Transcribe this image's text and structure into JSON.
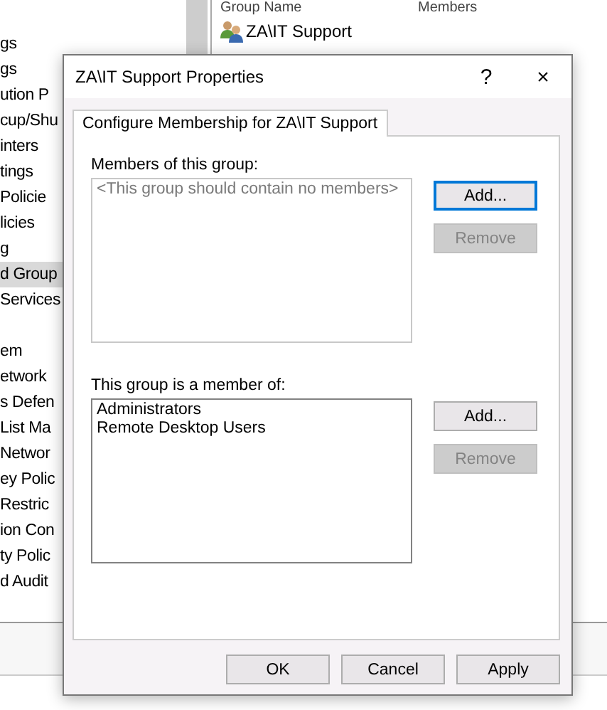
{
  "tree": {
    "items": [
      {
        "label": "gs",
        "selected": false
      },
      {
        "label": "gs",
        "selected": false
      },
      {
        "label": "ution P",
        "selected": false
      },
      {
        "label": "cup/Shu",
        "selected": false
      },
      {
        "label": "inters",
        "selected": false
      },
      {
        "label": "tings",
        "selected": false
      },
      {
        "label": "Policie",
        "selected": false
      },
      {
        "label": "licies",
        "selected": false
      },
      {
        "label": "g",
        "selected": false
      },
      {
        "label": "d Group",
        "selected": true
      },
      {
        "label": "Services",
        "selected": false
      },
      {
        "selected": false
      },
      {
        "label": "em",
        "selected": false
      },
      {
        "label": "etwork",
        "selected": false
      },
      {
        "label": "s Defen",
        "selected": false
      },
      {
        "label": "List Ma",
        "selected": false
      },
      {
        "label": "Networ",
        "selected": false
      },
      {
        "label": "ey Polic",
        "selected": false
      },
      {
        "label": "Restric",
        "selected": false
      },
      {
        "label": "ion Con",
        "selected": false
      },
      {
        "label": "ty Polic",
        "selected": false
      },
      {
        "label": "d Audit",
        "selected": false
      }
    ]
  },
  "list": {
    "columns": [
      "Group Name",
      "Members"
    ],
    "rows": [
      {
        "name": "ZA\\IT Support"
      }
    ]
  },
  "dialog": {
    "title": "ZA\\IT Support Properties",
    "help": "?",
    "close": "×",
    "tabs": [
      {
        "label": "Configure Membership for ZA\\IT Support",
        "selected": true
      }
    ],
    "sections": [
      {
        "label": "Members of this group:",
        "placeholder": "<This group should contain no members>",
        "buttons": [
          {
            "label": "Add...",
            "focused": true,
            "disabled": false
          },
          {
            "label": "Remove",
            "focused": false,
            "disabled": true
          }
        ]
      },
      {
        "label": "This group is a member of:",
        "items": [
          "Administrators",
          "Remote Desktop Users"
        ],
        "buttons": [
          {
            "label": "Add...",
            "focused": false,
            "disabled": false
          },
          {
            "label": "Remove",
            "focused": false,
            "disabled": true
          }
        ]
      }
    ],
    "buttons": [
      "OK",
      "Cancel",
      "Apply"
    ]
  }
}
